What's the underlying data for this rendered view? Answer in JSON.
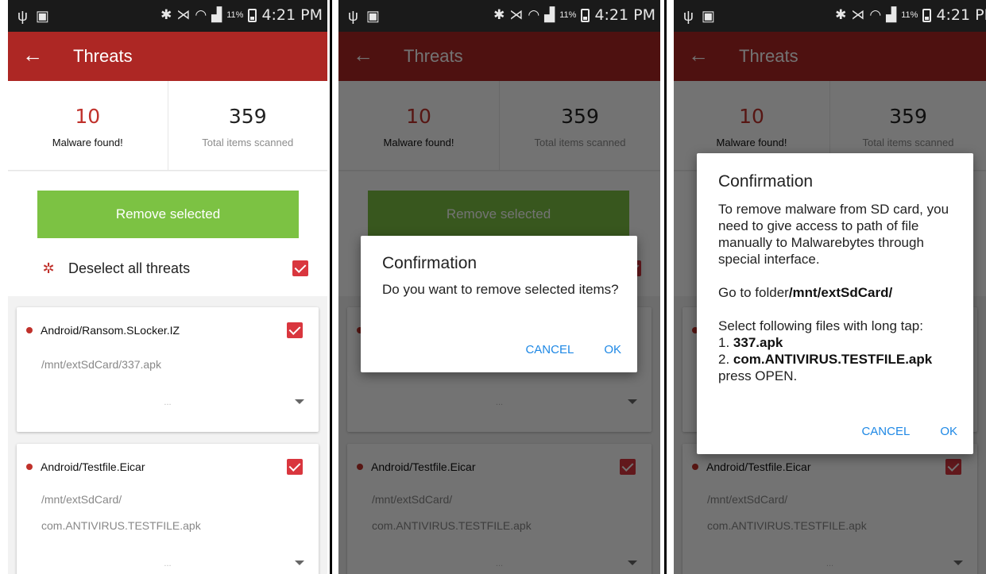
{
  "status": {
    "usb_icon": "usb-icon",
    "sd_icon": "sd-card-icon",
    "bluetooth_icon": "bluetooth-icon",
    "mute_icon": "mute-icon",
    "wifi_icon": "wifi-icon",
    "signal_icon": "signal-icon",
    "battery_pct": "11%",
    "time": "4:21 PM"
  },
  "appbar": {
    "title": "Threats"
  },
  "stats": {
    "malware_count": "10",
    "malware_label": "Malware found!",
    "scanned_count": "359",
    "scanned_label": "Total items scanned"
  },
  "actions": {
    "remove_label": "Remove selected",
    "deselect_label": "Deselect all threats"
  },
  "threats": [
    {
      "name": "Android/Ransom.SLocker.IZ",
      "path_lines": [
        "/mnt/extSdCard/337.apk"
      ],
      "more": "..."
    },
    {
      "name": "Android/Testfile.Eicar",
      "path_lines": [
        "/mnt/extSdCard/",
        "com.ANTIVIRUS.TESTFILE.apk"
      ],
      "more": "..."
    }
  ],
  "dialog_remove": {
    "title": "Confirmation",
    "message": "Do you want to remove selected items?",
    "cancel": "CANCEL",
    "ok": "OK"
  },
  "dialog_sdcard": {
    "title": "Confirmation",
    "intro": "To remove malware from SD card, you need to give access to path of file manually to Malwarebytes through special interface.",
    "goto_prefix": "Go to folder",
    "goto_folder": "/mnt/extSdCard/",
    "select_text": "Select following files with long tap:",
    "file1_prefix": "1. ",
    "file1": "337.apk",
    "file2_prefix": "2. ",
    "file2": "com.ANTIVIRUS.TESTFILE.apk",
    "press_open": "press OPEN.",
    "cancel": "CANCEL",
    "ok": "OK"
  },
  "colors": {
    "appbar": "#ad2724",
    "accent_green": "#7cc243",
    "danger_red": "#c0312b",
    "checkbox_red": "#d9363e",
    "dialog_button_blue": "#1e88e5"
  }
}
